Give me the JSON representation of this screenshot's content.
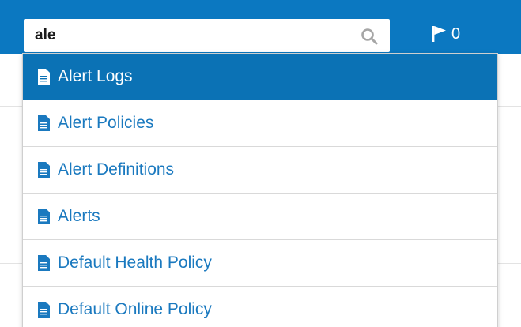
{
  "header": {
    "search": {
      "value": "ale",
      "placeholder": ""
    },
    "flag": {
      "count": "0"
    },
    "colors": {
      "accent": "#0b78c1",
      "active_row": "#0b72b5",
      "link": "#1a79bf"
    }
  },
  "suggestions": {
    "items": [
      {
        "label": "Alert Logs",
        "icon": "document-icon",
        "active": true
      },
      {
        "label": "Alert Policies",
        "icon": "document-icon",
        "active": false
      },
      {
        "label": "Alert Definitions",
        "icon": "document-icon",
        "active": false
      },
      {
        "label": "Alerts",
        "icon": "document-icon",
        "active": false
      },
      {
        "label": "Default Health Policy",
        "icon": "document-icon",
        "active": false
      },
      {
        "label": "Default Online Policy",
        "icon": "document-icon",
        "active": false
      }
    ]
  }
}
